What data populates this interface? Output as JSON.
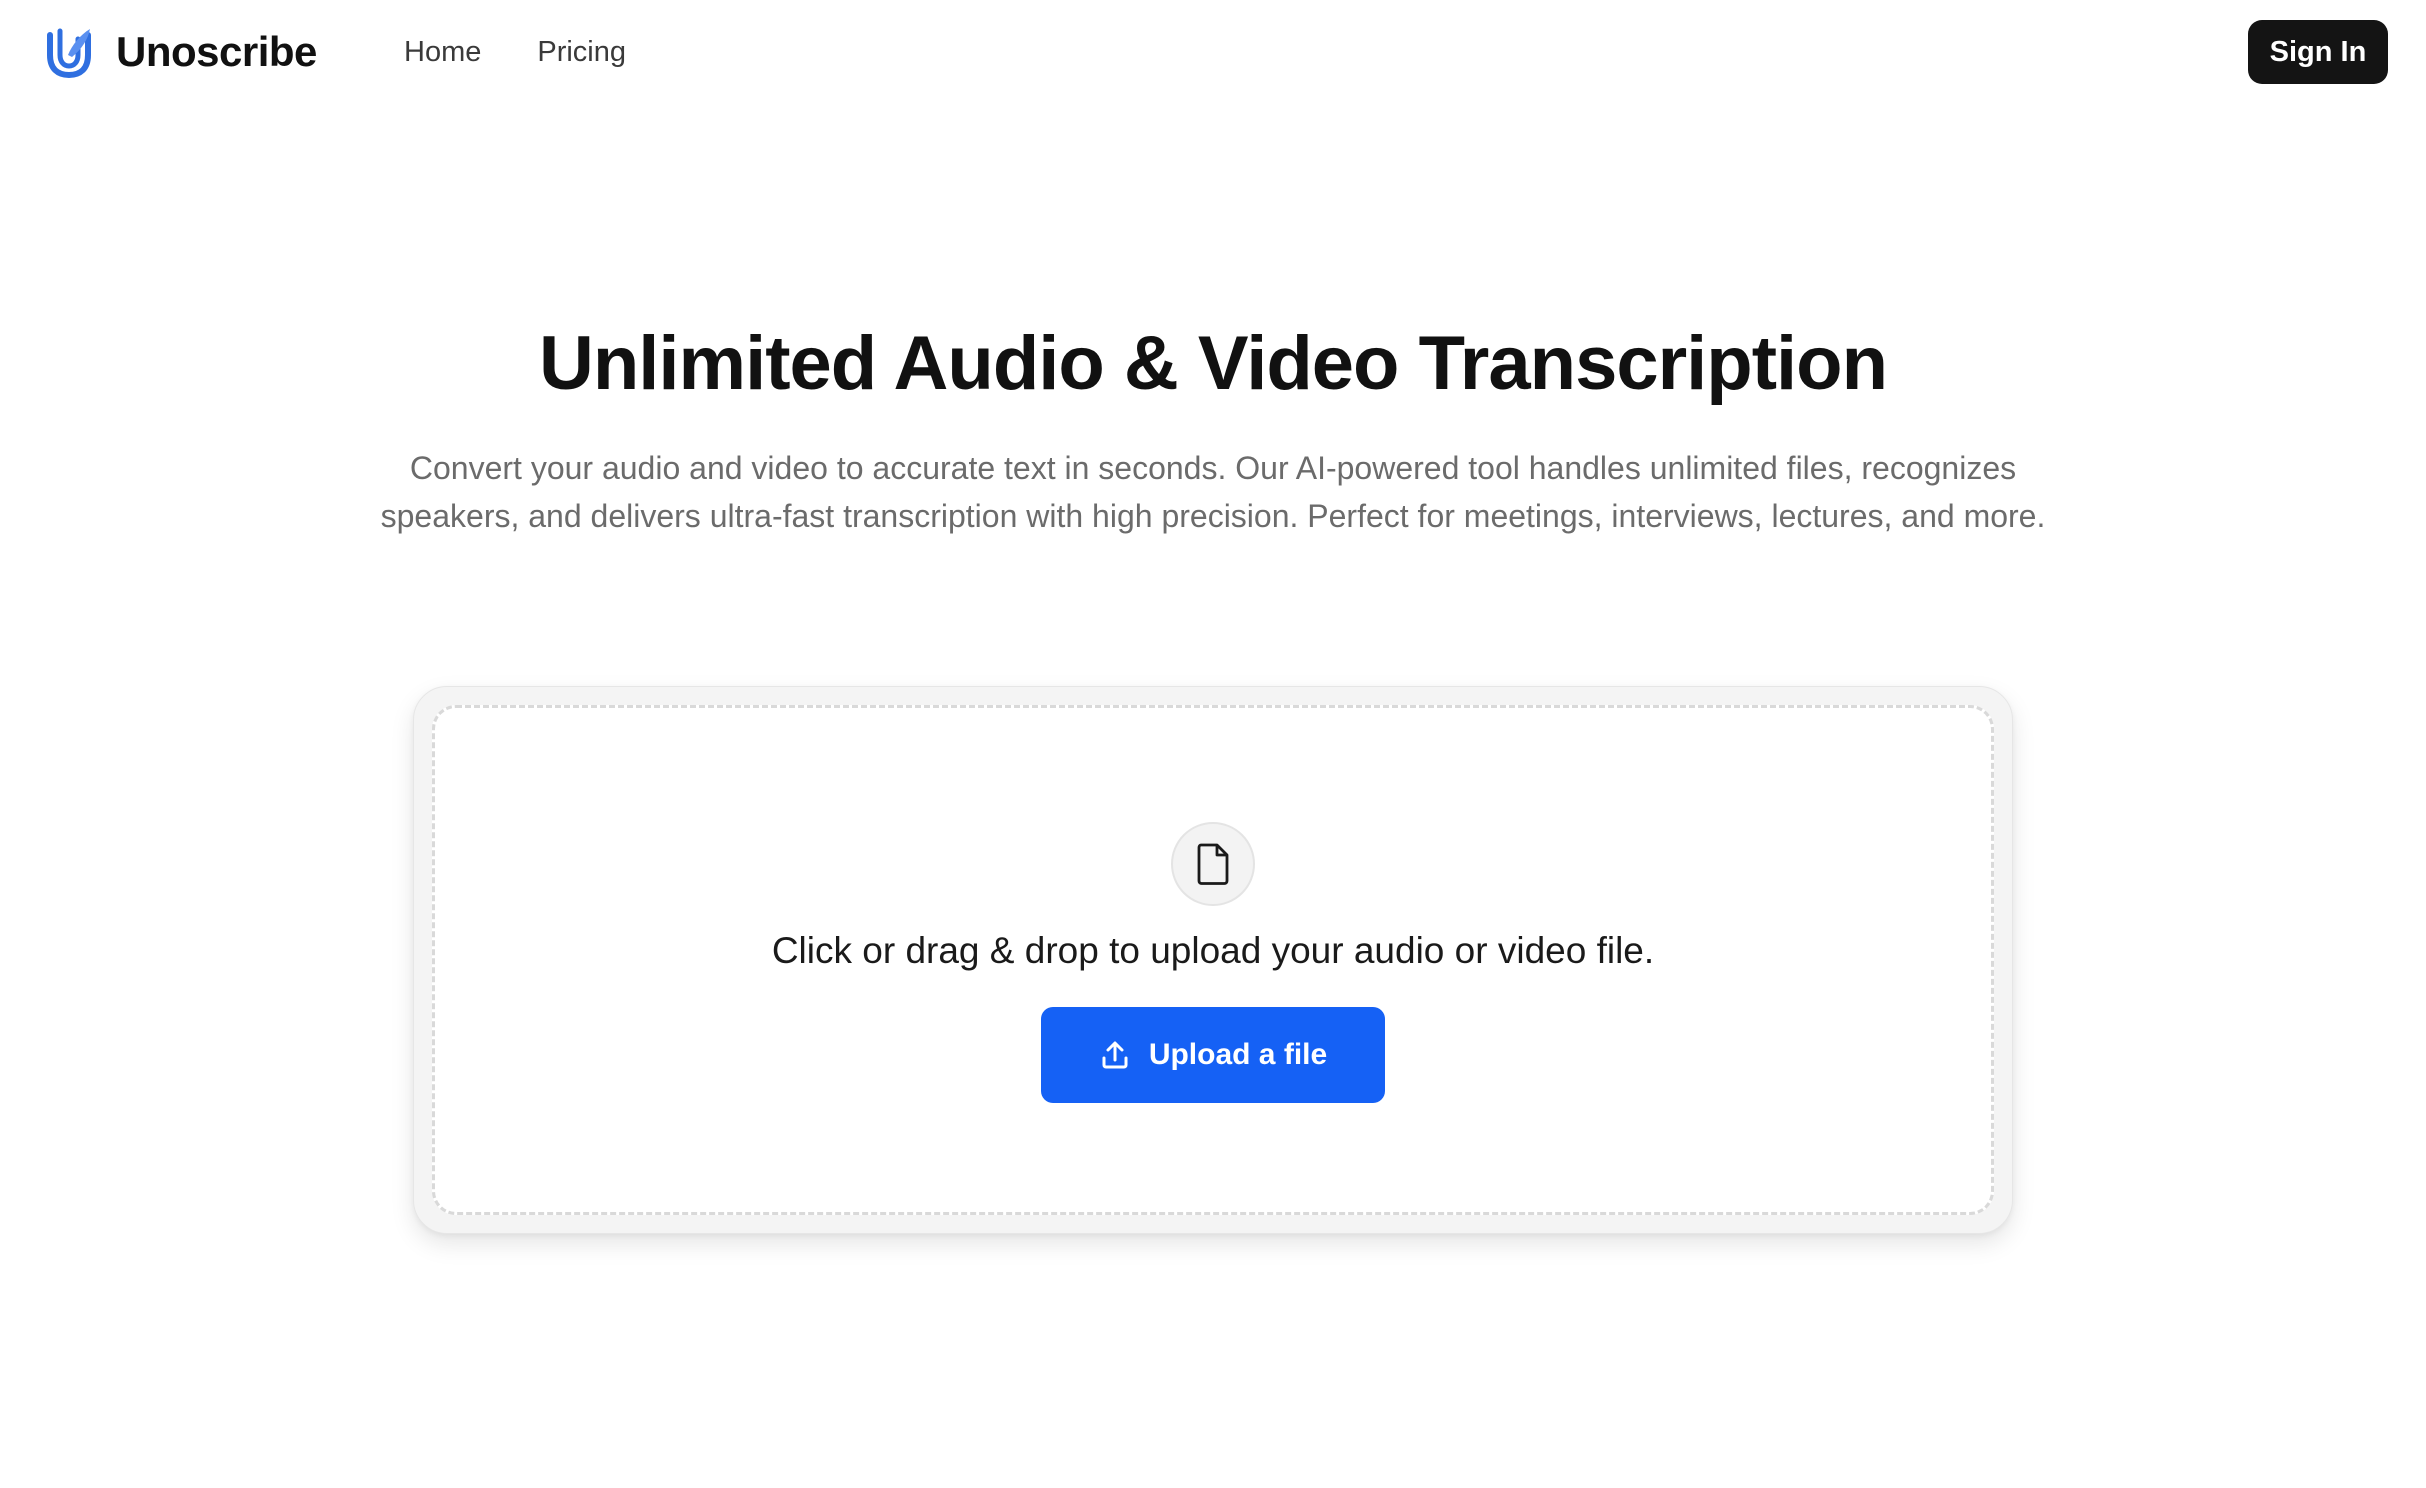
{
  "header": {
    "brand_name": "Unoscribe",
    "logo_icon": "unoscribe-logo-icon",
    "nav": [
      {
        "label": "Home"
      },
      {
        "label": "Pricing"
      }
    ],
    "signin_label": "Sign In"
  },
  "hero": {
    "title": "Unlimited Audio & Video Transcription",
    "subtitle": "Convert your audio and video to accurate text in seconds. Our AI-powered tool handles unlimited files, recognizes speakers, and delivers ultra-fast transcription with high precision. Perfect for meetings, interviews, lectures, and more."
  },
  "upload": {
    "file_icon": "file-icon",
    "prompt": "Click or drag & drop to upload your audio or video file.",
    "button_icon": "upload-icon",
    "button_label": "Upload a file"
  },
  "colors": {
    "brand_blue": "#1561f5",
    "logo_blue": "#2f6fe0",
    "signin_bg": "#141414",
    "text_muted": "#6b6b6b",
    "card_bg": "#f4f4f4"
  }
}
